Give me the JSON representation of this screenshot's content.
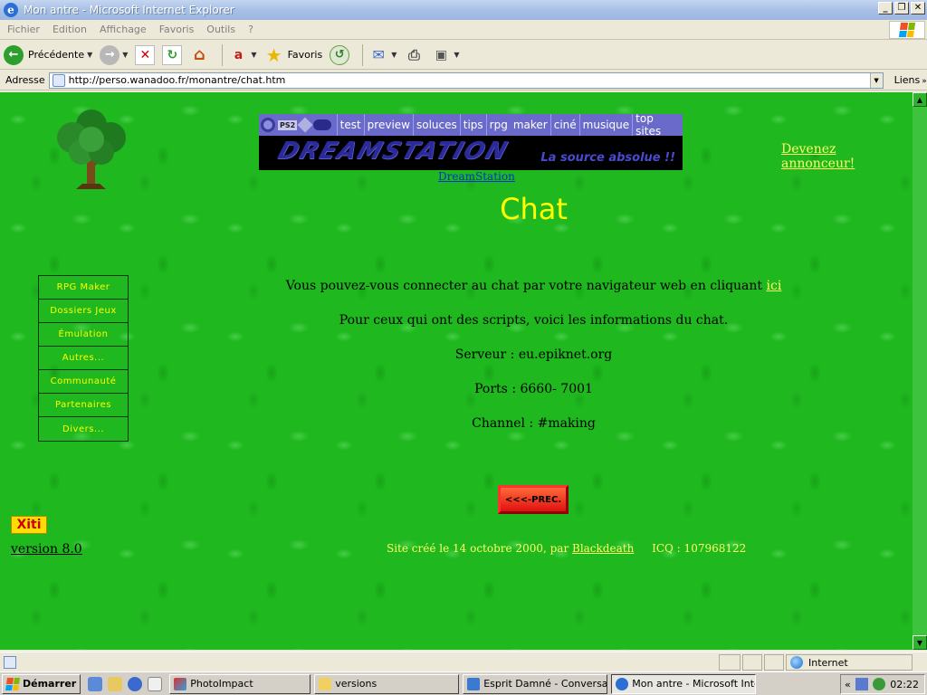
{
  "window": {
    "title": "Mon antre - Microsoft Internet Explorer",
    "min_glyph": "_",
    "max_glyph": "❐",
    "close_glyph": "✕"
  },
  "menu": {
    "items": [
      "Fichier",
      "Edition",
      "Affichage",
      "Favoris",
      "Outils",
      "?"
    ]
  },
  "toolbar": {
    "back_label": "Précédente",
    "favorites_label": "Favoris"
  },
  "address": {
    "label": "Adresse",
    "url": "http://perso.wanadoo.fr/monantre/chat.htm",
    "links_label": "Liens"
  },
  "banner": {
    "nav": [
      "test",
      "preview",
      "soluces",
      "tips",
      "rpg",
      "maker",
      "ciné",
      "musique",
      "top sites"
    ],
    "wordmark": "DREAMSTATION",
    "tagline": "La source absolue !!",
    "ps2_badge": "PS2"
  },
  "page": {
    "dreamstation_link": "DreamStation",
    "advertise_link": "Devenez annonceur!",
    "title": "Chat",
    "connect_text": "Vous pouvez-vous connecter au chat par votre navigateur web en cliquant ",
    "connect_link": "ici",
    "scripts_text": "Pour ceux qui ont des scripts, voici les informations du chat.",
    "server_text": "Serveur : eu.epiknet.org",
    "ports_text": "Ports : 6660- 7001",
    "channel_text": "Channel : #making",
    "prev_button": "<<<-PREC.",
    "xiti_badge": "Xiti",
    "version_link": "version 8.0",
    "footer_prefix": "Site créé  le 14 octobre 2000, par ",
    "footer_author": "Blackdeath",
    "footer_icq": "ICQ : 107968122"
  },
  "side_menu": {
    "items": [
      "RPG Maker",
      "Dossiers Jeux",
      "Émulation",
      "Autres...",
      "Communauté",
      "Partenaires",
      "Divers..."
    ]
  },
  "status": {
    "zone": "Internet"
  },
  "taskbar": {
    "start_label": "Démarrer",
    "tasks": [
      "PhotoImpact",
      "versions",
      "Esprit Damné - Conversati...",
      "Mon antre - Microsoft Inte..."
    ],
    "tray_collapse": "«",
    "clock": "02:22"
  },
  "colors": {
    "page_background": "#1fb81f",
    "title_yellow": "#ffff00",
    "link_yellow": "#ffff66",
    "banner_nav": "#6a6acb",
    "button_red": "#e01010"
  }
}
